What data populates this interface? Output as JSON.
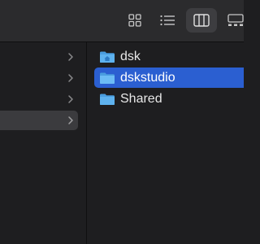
{
  "toolbar": {
    "view_buttons": [
      {
        "icon": "icon-view-grid-icon",
        "active": false
      },
      {
        "icon": "list-view-icon",
        "active": false
      },
      {
        "icon": "column-view-icon",
        "active": true
      },
      {
        "icon": "gallery-view-icon",
        "active": false
      }
    ]
  },
  "sidebar_column": {
    "rows": [
      {
        "has_chevron": true,
        "selected": false
      },
      {
        "has_chevron": true,
        "selected": false
      },
      {
        "has_chevron": true,
        "selected": false
      },
      {
        "has_chevron": true,
        "selected": true
      }
    ]
  },
  "files": [
    {
      "name": "dsk",
      "icon": "home-folder-icon",
      "selected": false
    },
    {
      "name": "dskstudio",
      "icon": "folder-icon",
      "selected": true
    },
    {
      "name": "Shared",
      "icon": "folder-icon",
      "selected": false
    }
  ],
  "colors": {
    "selection": "#2b5fd1",
    "folder": "#5eb2ef",
    "background": "#1e1e20",
    "toolbar": "#2b2b2d"
  }
}
